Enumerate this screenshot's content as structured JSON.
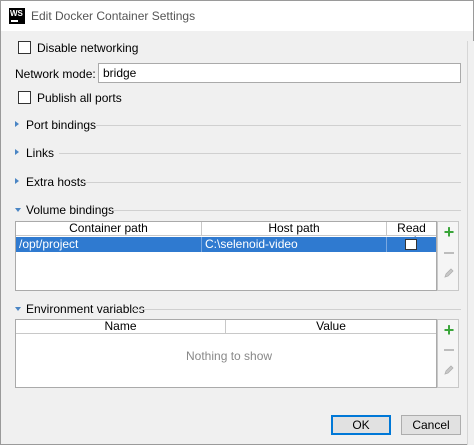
{
  "window": {
    "app_icon_text": "WS",
    "title": "Edit Docker Container Settings"
  },
  "options": {
    "disable_networking_label": "Disable networking",
    "disable_networking_checked": false,
    "network_mode_label": "Network mode:",
    "network_mode_value": "bridge",
    "publish_all_ports_label": "Publish all ports",
    "publish_all_ports_checked": false
  },
  "sections": {
    "port_bindings": "Port bindings",
    "links": "Links",
    "extra_hosts": "Extra hosts",
    "volume_bindings": "Volume bindings",
    "environment_variables": "Environment variables"
  },
  "volume_table": {
    "columns": [
      "Container path",
      "Host path",
      "Read only"
    ],
    "rows": [
      {
        "container_path": "/opt/project",
        "host_path": "C:\\selenoid-video",
        "read_only": false
      }
    ]
  },
  "env_table": {
    "columns": [
      "Name",
      "Value"
    ],
    "empty_text": "Nothing to show"
  },
  "buttons": {
    "ok": "OK",
    "cancel": "Cancel"
  },
  "colors": {
    "selection": "#2f7ad0",
    "add_icon": "#3aa53a",
    "section_arrow": "#4a85c4"
  }
}
